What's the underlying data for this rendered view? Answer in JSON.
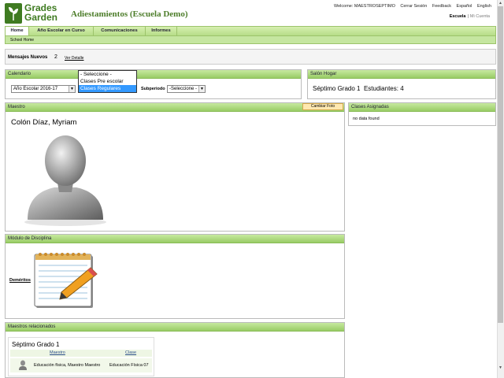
{
  "header": {
    "logo_line1": "Grades",
    "logo_line2": "Garden",
    "school_title": "Adiestamientos (Escuela Demo)",
    "top_links": [
      "Welcome: MAESTROSEPTIMO",
      "Cerrar Sesión",
      "Feedback",
      "Español",
      "English"
    ],
    "scope_active": "Escuela",
    "scope_separator": "|",
    "scope_other": "Mi Cuenta"
  },
  "nav": {
    "tabs": [
      "Home",
      "Año Escolar en Curso",
      "Comunicaciones",
      "Informes"
    ],
    "active": "Home",
    "subnav": "School Home"
  },
  "messages": {
    "label": "Mensajes Nuevos",
    "count": "2",
    "link": "Ver Detalle"
  },
  "calendar": {
    "title": "Calendario",
    "year_select": "Año Escolar 2016-17",
    "subperiod_label": "Subperiodo",
    "subperiod_select": "-Seleccione -",
    "dropdown_options": [
      "- Seleccione -",
      "Clases Pre escolar",
      "Clases Regulares"
    ],
    "dropdown_highlighted": "Clases Regulares"
  },
  "homeroom": {
    "title": "Salón Hogar",
    "grade": "Séptimo Grado 1",
    "students_label": "Estudiantes:",
    "students_count": "4"
  },
  "teacher": {
    "title": "Maestro",
    "change_photo": "Cambiar Foto",
    "name": "Colón Díaz, Myriam"
  },
  "assigned": {
    "title": "Clases Asignadas",
    "empty": "no data found"
  },
  "discipline": {
    "title": "Módulo de Disciplina",
    "demerits": "Deméritos"
  },
  "related": {
    "title": "Maestros relacionados",
    "group": "Séptimo Grado 1",
    "col_teacher": "Maestro",
    "col_class": "Clase",
    "row_teacher": "Educación física, Maestro Maestro",
    "row_class": "Educación Física 07"
  },
  "colors": {
    "brand_green": "#3f7b21",
    "header_green": "#99cc66",
    "highlight_blue": "#3399ff"
  }
}
